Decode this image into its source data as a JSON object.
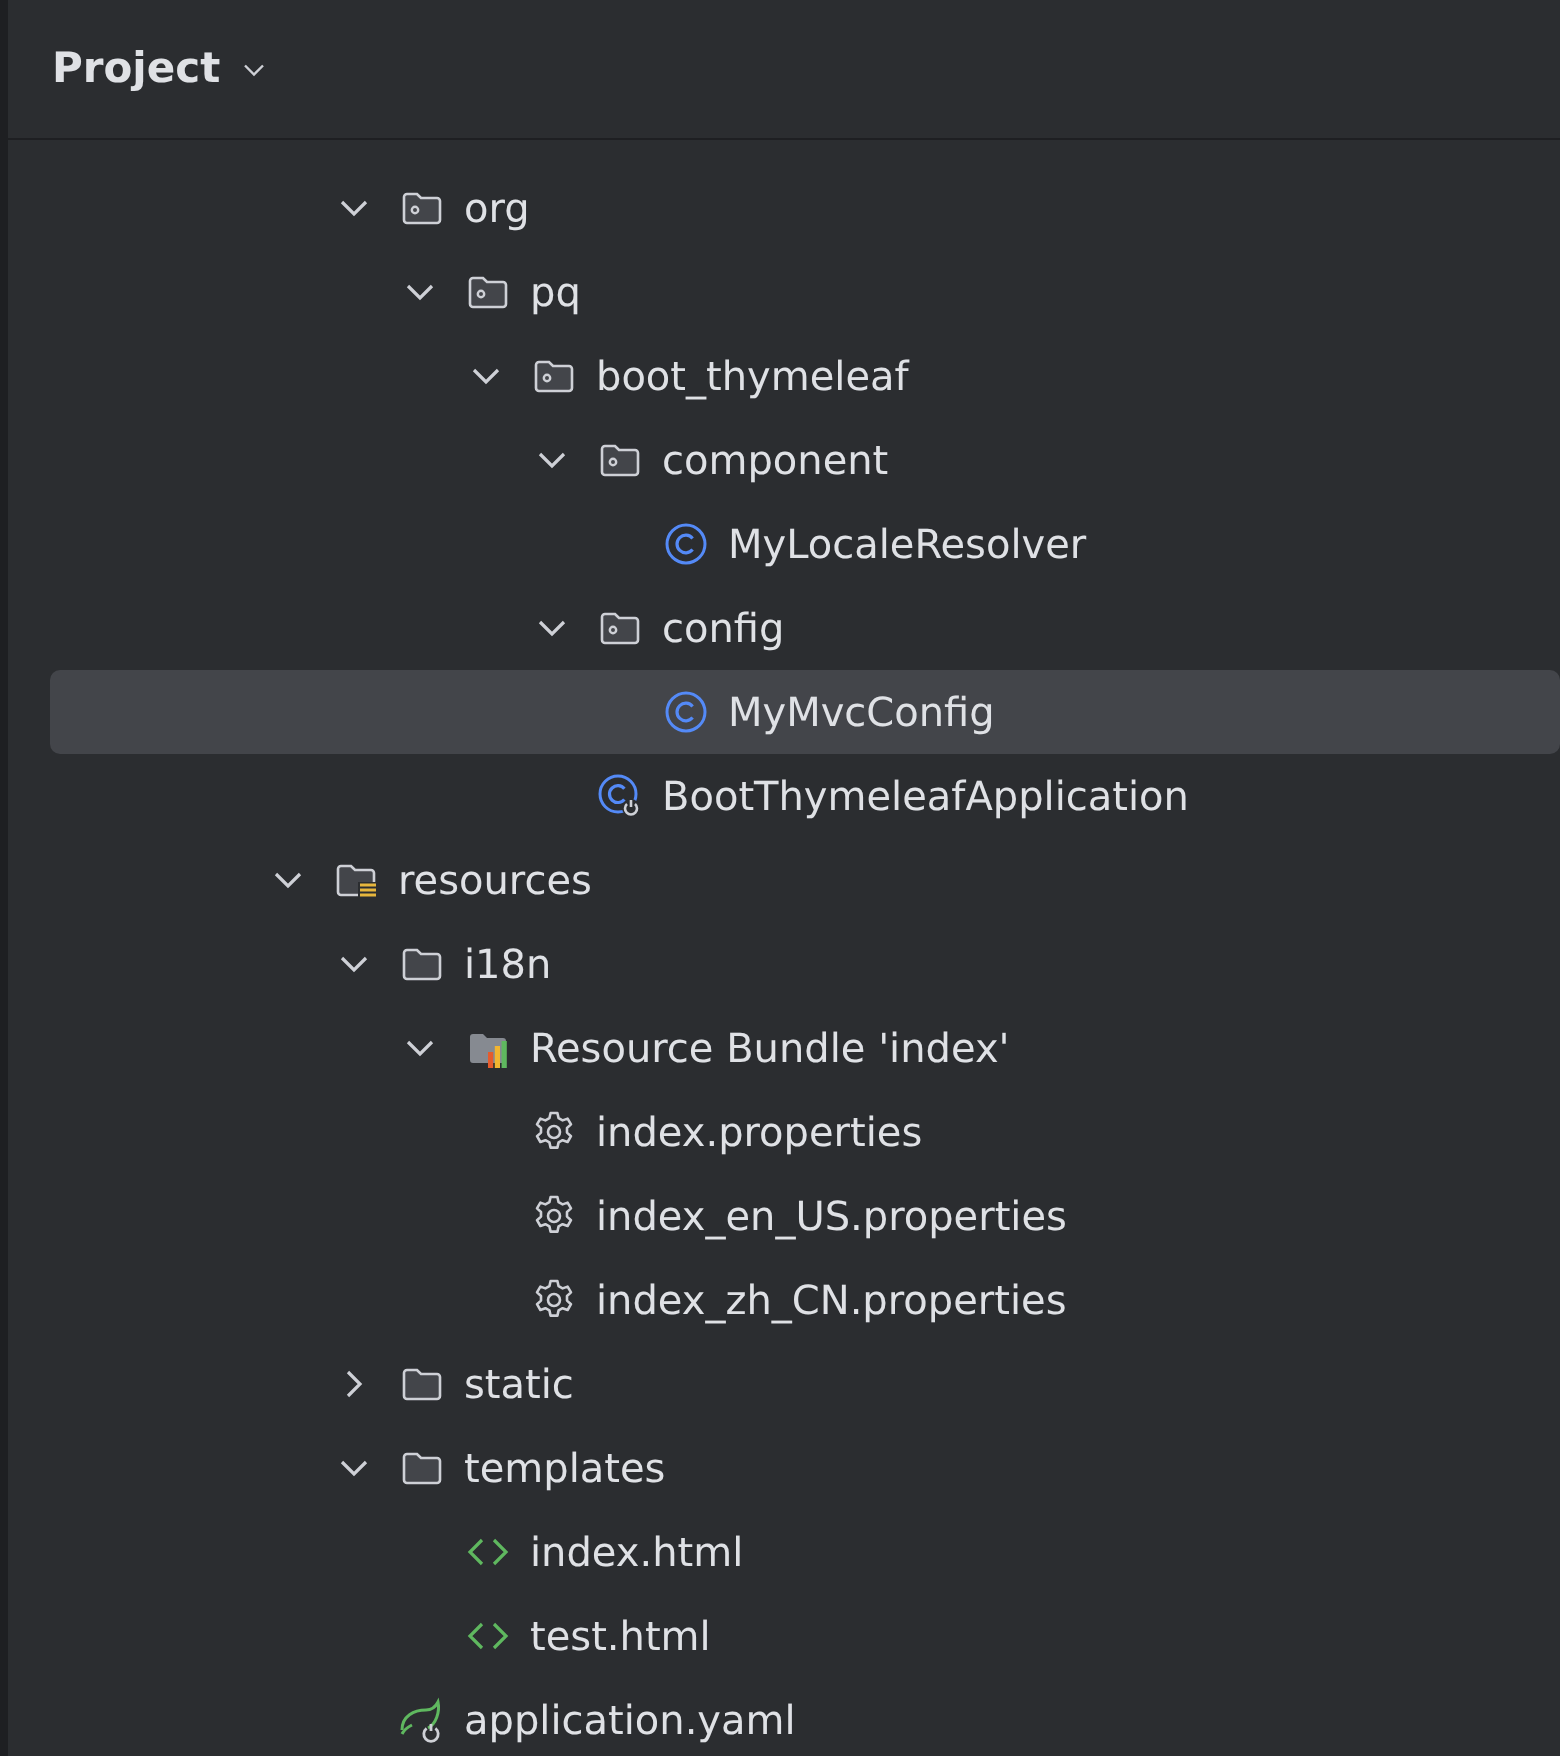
{
  "panel": {
    "title": "Project"
  },
  "tree": [
    {
      "children": [
        {
          "label": "org",
          "kind": "package",
          "expanded": true,
          "selected": false,
          "children": [
            {
              "label": "pq",
              "kind": "package",
              "expanded": true,
              "selected": false,
              "children": [
                {
                  "label": "boot_thymeleaf",
                  "kind": "package",
                  "expanded": true,
                  "selected": false,
                  "children": [
                    {
                      "label": "component",
                      "kind": "package",
                      "expanded": true,
                      "selected": false,
                      "children": [
                        {
                          "label": "MyLocaleResolver",
                          "kind": "class",
                          "selected": false
                        }
                      ]
                    },
                    {
                      "label": "config",
                      "kind": "package",
                      "expanded": true,
                      "selected": false,
                      "children": [
                        {
                          "label": "MyMvcConfig",
                          "kind": "class",
                          "selected": true
                        }
                      ]
                    },
                    {
                      "label": "BootThymeleafApplication",
                      "kind": "spring-app",
                      "selected": false
                    }
                  ]
                }
              ]
            }
          ]
        }
      ]
    },
    {
      "label": "resources",
      "kind": "resource-root",
      "expanded": true,
      "selected": false,
      "children": [
        {
          "label": "i18n",
          "kind": "folder",
          "expanded": true,
          "selected": false,
          "children": [
            {
              "label": "Resource Bundle 'index'",
              "kind": "bundle",
              "expanded": true,
              "selected": false,
              "children": [
                {
                  "label": "index.properties",
                  "kind": "properties",
                  "selected": false
                },
                {
                  "label": "index_en_US.properties",
                  "kind": "properties",
                  "selected": false
                },
                {
                  "label": "index_zh_CN.properties",
                  "kind": "properties",
                  "selected": false
                }
              ]
            }
          ]
        },
        {
          "label": "static",
          "kind": "folder",
          "expanded": false,
          "selected": false
        },
        {
          "label": "templates",
          "kind": "folder",
          "expanded": true,
          "selected": false,
          "children": [
            {
              "label": "index.html",
              "kind": "html",
              "selected": false
            },
            {
              "label": "test.html",
              "kind": "html",
              "selected": false
            }
          ]
        },
        {
          "label": "application.yaml",
          "kind": "yaml",
          "selected": false
        }
      ]
    }
  ]
}
